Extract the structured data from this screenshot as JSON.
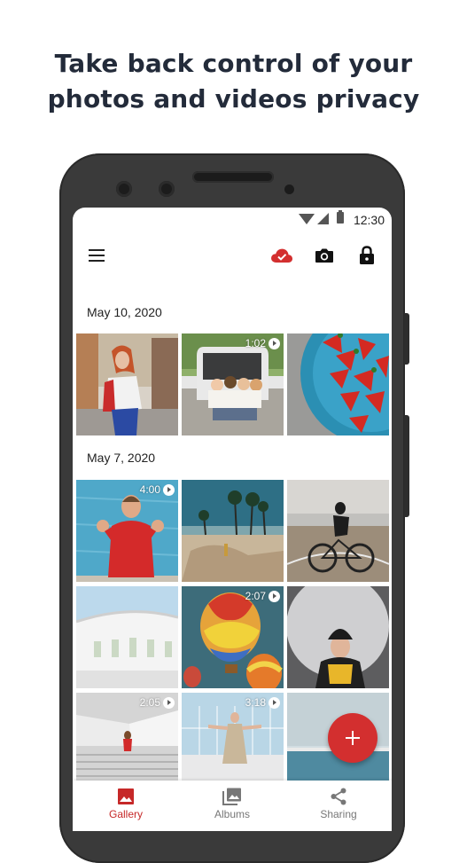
{
  "headline": {
    "line1": "Take back control of your",
    "line2": "photos and videos privacy"
  },
  "status_bar": {
    "time": "12:30"
  },
  "toolbar": {
    "menu_icon": "menu-icon",
    "cloud_icon": "cloud-check-icon",
    "camera_icon": "camera-icon",
    "lock_icon": "lock-icon",
    "accent": "#d32f2f"
  },
  "sections": [
    {
      "date": "May 10,  2020",
      "durations": [
        "",
        "1:02",
        ""
      ]
    },
    {
      "date": "May 7, 2020",
      "durations": [
        "4:00",
        "",
        "",
        "",
        "2:07",
        "",
        "2:05",
        "3:18",
        ""
      ]
    }
  ],
  "fab": {
    "icon": "plus-icon"
  },
  "bottom_nav": {
    "items": [
      {
        "label": "Gallery",
        "icon": "gallery-icon",
        "active": true
      },
      {
        "label": "Albums",
        "icon": "albums-icon",
        "active": false
      },
      {
        "label": "Sharing",
        "icon": "share-icon",
        "active": false
      }
    ],
    "active_color": "#c62828"
  }
}
